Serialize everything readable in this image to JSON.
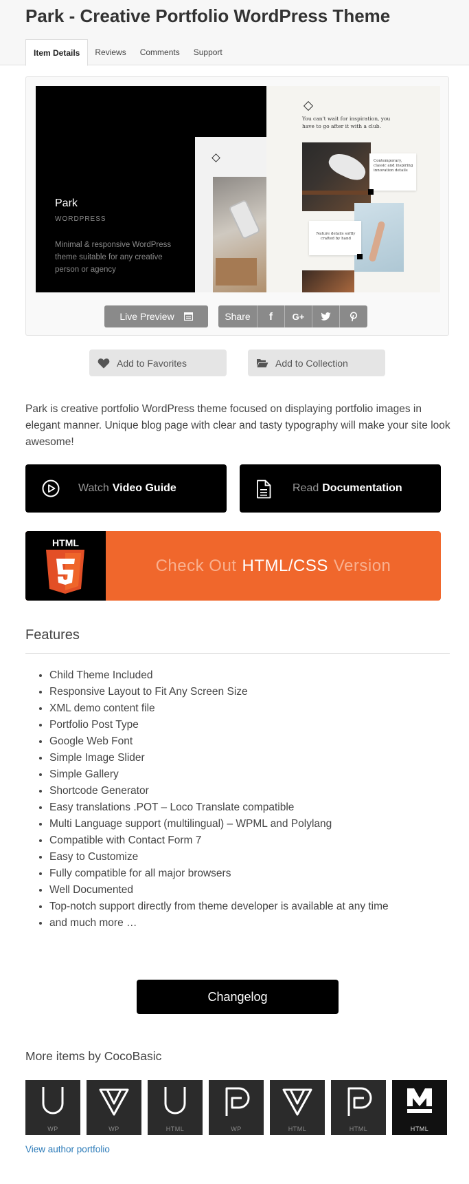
{
  "page": {
    "title": "Park - Creative Portfolio WordPress Theme"
  },
  "tabs": [
    {
      "label": "Item Details",
      "active": true
    },
    {
      "label": "Reviews",
      "active": false
    },
    {
      "label": "Comments",
      "active": false
    },
    {
      "label": "Support",
      "active": false
    }
  ],
  "preview": {
    "name": "Park",
    "subtitle": "WORDPRESS",
    "description": "Minimal & responsive WordPress theme suitable for any creative person or agency",
    "headline": "You can't wait for inspiration, you have to go after it with a club.",
    "card1": "Contemporary, classic and inspiring innovation details",
    "card2": "Nature details softly crafted by hand"
  },
  "actions": {
    "live_preview": "Live Preview",
    "share": "Share",
    "share_icons": [
      "f",
      "G+",
      "twitter",
      "P"
    ],
    "favorites": "Add to Favorites",
    "collection": "Add to Collection"
  },
  "intro": "Park is creative portfolio WordPress theme focused on displaying portfolio images in elegant manner. Unique blog page with clear and tasty typography will make your site look awesome!",
  "guides": {
    "video_light": "Watch",
    "video_bold": "Video Guide",
    "doc_light": "Read",
    "doc_bold": "Documentation"
  },
  "html_banner": {
    "badge": "HTML",
    "before": "Check Out",
    "strong": "HTML/CSS",
    "after": "Version"
  },
  "features": {
    "heading": "Features",
    "items": [
      "Child Theme Included",
      "Responsive Layout to Fit Any Screen Size",
      "XML demo content file",
      "Portfolio Post Type",
      "Google Web Font",
      "Simple Image Slider",
      "Simple Gallery",
      "Shortcode Generator",
      "Easy translations .POT – Loco Translate compatible",
      "Multi Language support (multilingual) – WPML and Polylang",
      "Compatible with Contact Form 7",
      "Easy to Customize",
      "Fully compatible for all major browsers",
      "Well Documented",
      "Top-notch support directly from theme developer is available at any time",
      "and much more …"
    ]
  },
  "changelog": "Changelog",
  "more": {
    "heading": "More items by CocoBasic",
    "items": [
      {
        "icon": "u-icon",
        "label": "WP"
      },
      {
        "icon": "v-icon",
        "label": "WP"
      },
      {
        "icon": "u-icon",
        "label": "HTML"
      },
      {
        "icon": "p-icon",
        "label": "WP"
      },
      {
        "icon": "v-icon",
        "label": "HTML"
      },
      {
        "icon": "p-icon",
        "label": "HTML"
      },
      {
        "icon": "m-icon",
        "label": "HTML"
      }
    ],
    "author_link": "View author portfolio"
  },
  "colors": {
    "accent_orange": "#f0672c",
    "link_blue": "#2a7ab8",
    "button_gray": "#8a8a8a"
  }
}
